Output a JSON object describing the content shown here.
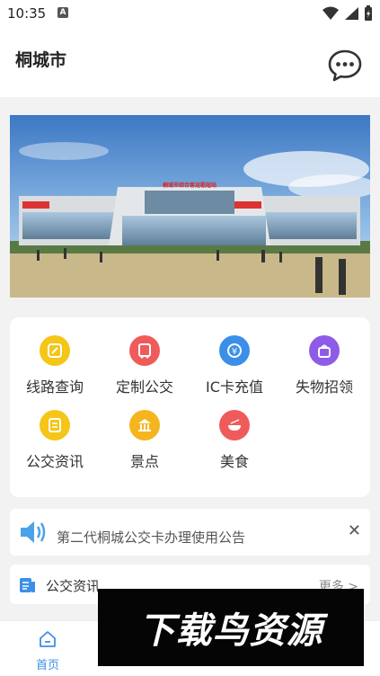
{
  "status_bar": {
    "time": "10:35",
    "notification_icon_letter": "A"
  },
  "header": {
    "title": "桐城市"
  },
  "banner": {
    "sign_text": "桐城市综合客运枢纽站"
  },
  "services": [
    {
      "label": "线路查询",
      "icon": "route-search-icon",
      "color": "#f5c518"
    },
    {
      "label": "定制公交",
      "icon": "custom-bus-icon",
      "color": "#ef5b5b"
    },
    {
      "label": "IC卡充值",
      "icon": "ic-card-recharge-icon",
      "color": "#3b8fe8"
    },
    {
      "label": "失物招领",
      "icon": "lost-found-icon",
      "color": "#8e5be8"
    },
    {
      "label": "公交资讯",
      "icon": "bus-news-icon",
      "color": "#f5c518"
    },
    {
      "label": "景点",
      "icon": "scenic-spot-icon",
      "color": "#f5b51e"
    },
    {
      "label": "美食",
      "icon": "food-icon",
      "color": "#ef5b5b"
    }
  ],
  "notice": {
    "text": "第二代桐城公交卡办理使用公告",
    "close": "✕"
  },
  "news": {
    "title": "公交资讯",
    "more": "更多"
  },
  "tabbar": {
    "home_label": "首页",
    "accent": "#3f8ee8"
  },
  "watermark": {
    "text": "下载鸟资源"
  }
}
